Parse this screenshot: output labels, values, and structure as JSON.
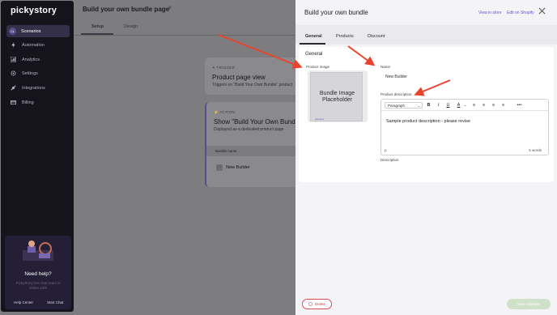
{
  "app": {
    "logo": "pickystory"
  },
  "sidebar": {
    "items": [
      {
        "label": "Scenarios",
        "icon": "avatar-initials",
        "initials": "CL",
        "active": true
      },
      {
        "label": "Automation",
        "icon": "bolt-icon"
      },
      {
        "label": "Analytics",
        "icon": "chart-icon"
      },
      {
        "label": "Settings",
        "icon": "gear-icon"
      },
      {
        "label": "Integrations",
        "icon": "plug-icon"
      },
      {
        "label": "Billing",
        "icon": "card-icon"
      }
    ],
    "help": {
      "title": "Need help?",
      "subtitle": "PickyStory live chat team is online 24/5",
      "help_center": "Help Center",
      "start_chat": "Start Chat"
    }
  },
  "page": {
    "title": "Build your own bundle page",
    "tabs": [
      {
        "label": "Setup",
        "active": true
      },
      {
        "label": "Design"
      }
    ],
    "trigger_card": {
      "tag": "TRIGGER",
      "title": "Product page view",
      "subtitle": "Triggers on \"Build Your Own Bundle\" product"
    },
    "action_card": {
      "tag": "ACTION",
      "title": "Show \"Build Your Own Bundle\"",
      "subtitle": "Displayed as a dedicated product page",
      "table_header": "Bundle name",
      "row": "New Builder"
    }
  },
  "drawer": {
    "title": "Build your own bundle",
    "view_in_store": "View in store",
    "edit_on_shopify": "Edit on Shopify",
    "tabs": [
      {
        "label": "General",
        "active": true
      },
      {
        "label": "Products"
      },
      {
        "label": "Discount"
      }
    ],
    "section_title": "General",
    "product_image_label": "Product image",
    "image_placeholder": "Bundle Image Placeholder",
    "image_watermark": "pickystory",
    "name_label": "Name",
    "name_value": "New Builder",
    "description_label": "Product description",
    "editor": {
      "format": "Paragraph",
      "content": "Sample product description - please revise",
      "path": "p",
      "word_count": "5 words"
    },
    "description_helper": "Description",
    "delete_label": "Delete",
    "save_label": "Save changes"
  },
  "colors": {
    "accent": "#6b4fd0",
    "danger": "#e04b4b",
    "annotation_arrow": "#e8442c",
    "sidebar_bg": "#15131c"
  }
}
